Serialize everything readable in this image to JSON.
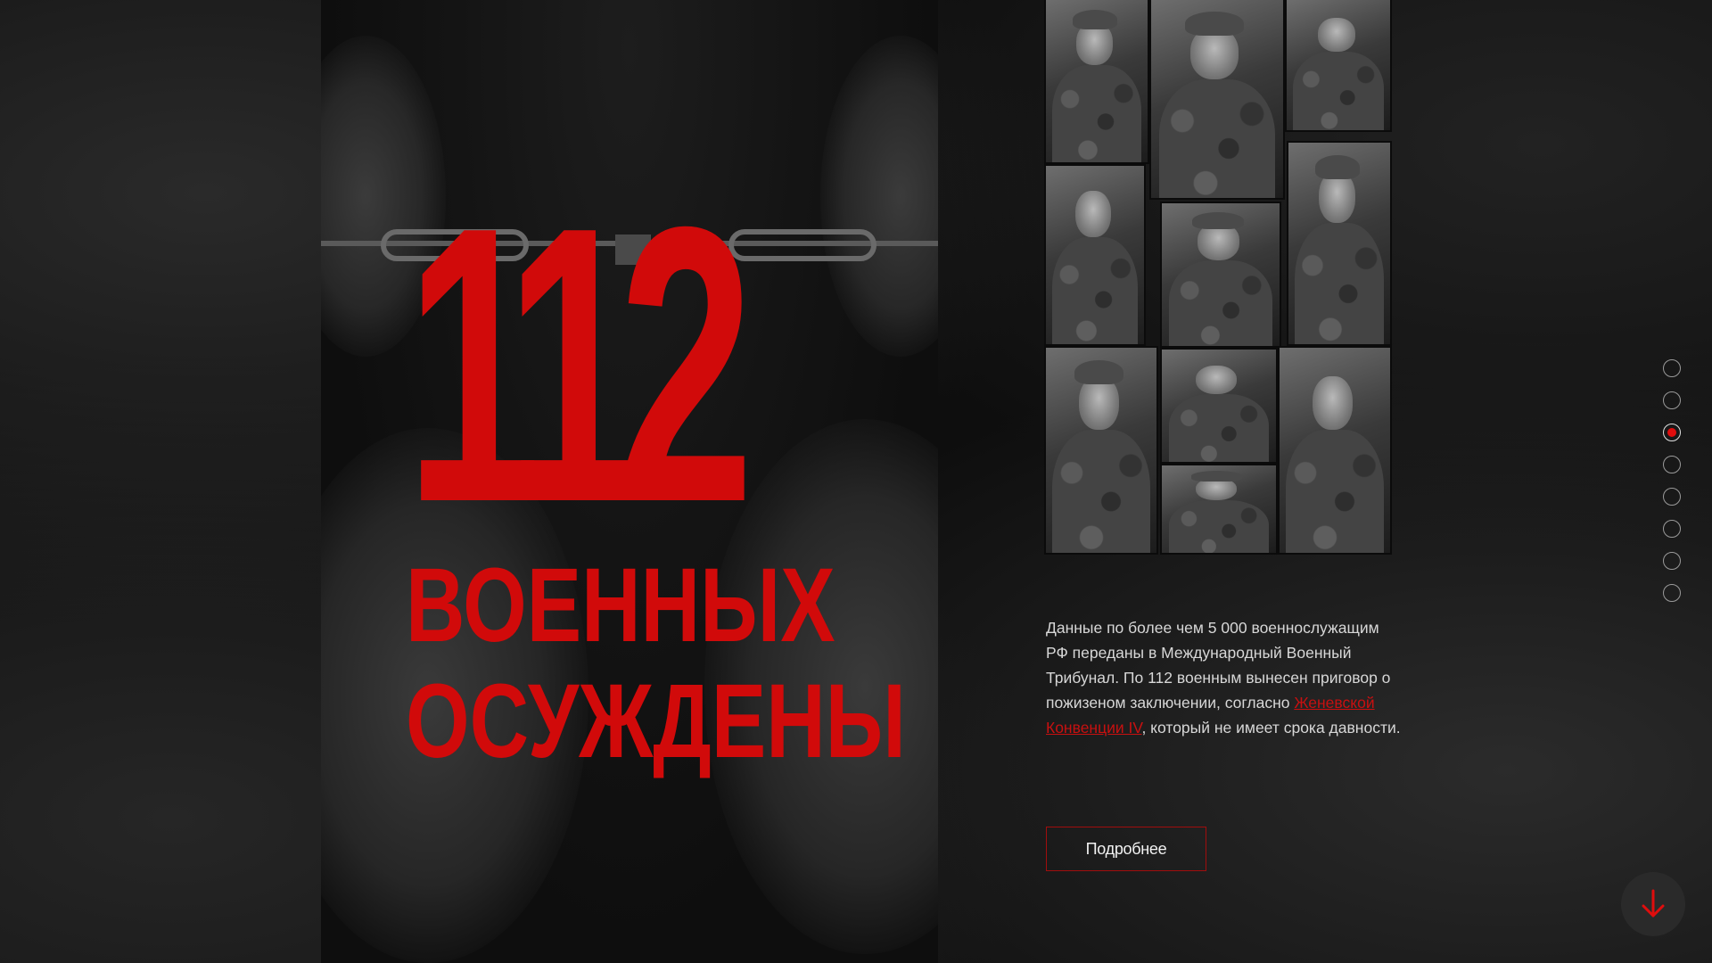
{
  "hero": {
    "number": "112",
    "line1": "ВОЕННЫХ",
    "line2": "ОСУЖДЕНЫ"
  },
  "collage": {
    "photo_count": 11
  },
  "description": {
    "text_before_link": "Данные по более чем 5 000 военнослужащим РФ переданы в Международный Военный Трибунал. По 112 военным  вынесен приговор о пожизеном заключении, согласно ",
    "link_text": "Женевской Конвенции IV",
    "text_after_link": ", который не имеет срока давности."
  },
  "more_button": {
    "label": "Подробнее"
  },
  "slide_nav": {
    "count": 8,
    "active_index": 2
  },
  "colors": {
    "accent_red": "#d10a0a",
    "background": "#0e0e0e",
    "text": "#d7d7d7"
  },
  "icons": {
    "scroll_down": "arrow-down-icon"
  }
}
